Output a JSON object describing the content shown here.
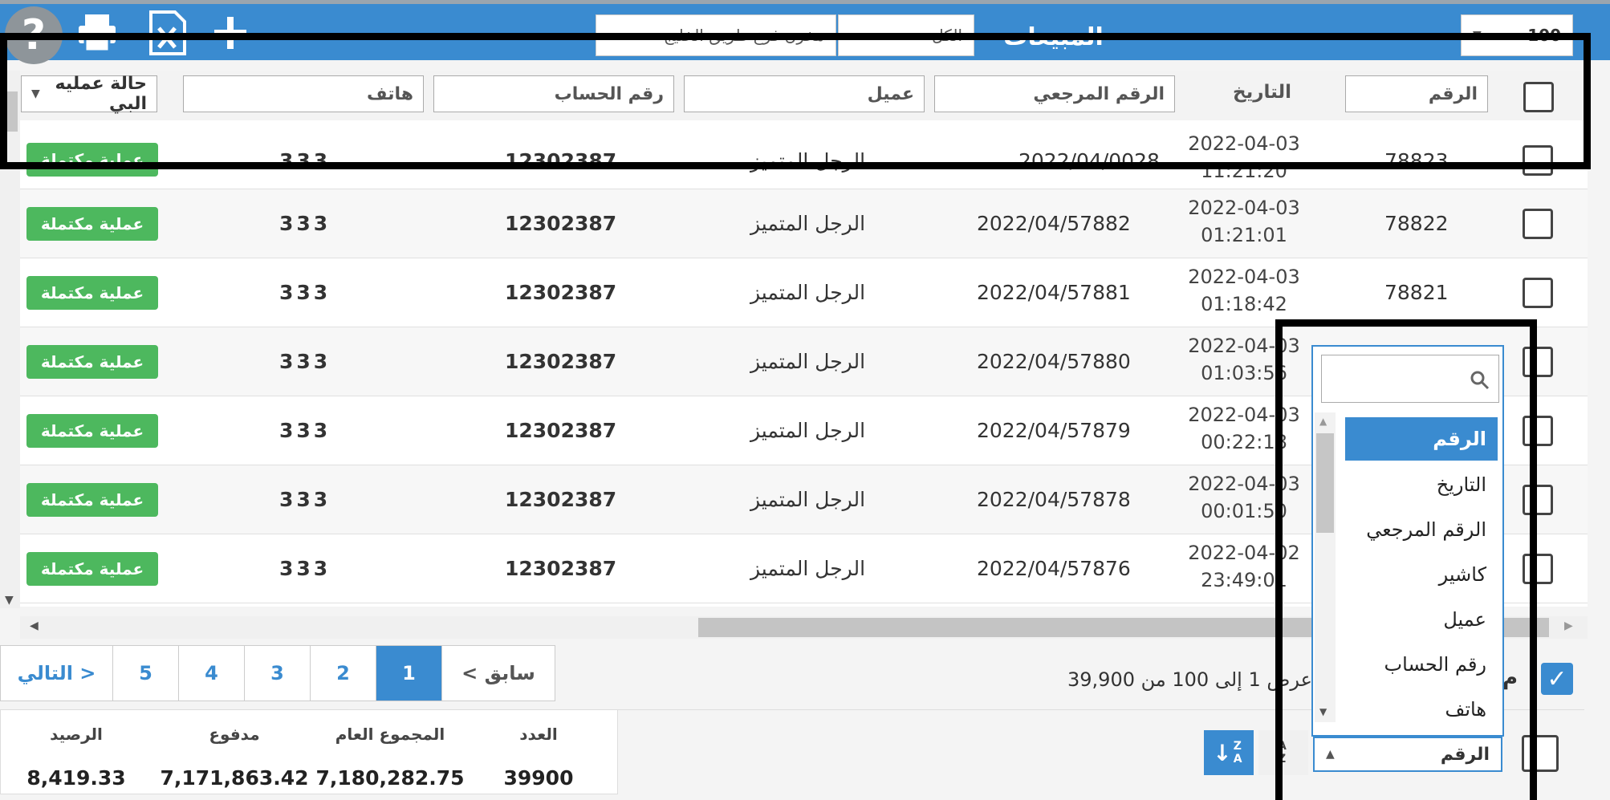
{
  "topbar": {
    "page_size": "100",
    "page_title": "المبيعات",
    "filter_all": "الكل",
    "branch": "مخزن فرع طريق الخليج",
    "help_label": "?"
  },
  "header": {
    "number": "الرقم",
    "date": "التاريخ",
    "reference": "الرقم المرجعي",
    "customer": "عميل",
    "account": "رقم الحساب",
    "phone": "هاتف",
    "status": "حالة عمليه البي"
  },
  "rows": [
    {
      "number": "78823",
      "date": "2022-04-03",
      "time": "11:21:20",
      "reference": "2022/04/0028",
      "customer": "الرجل المتميز",
      "account": "12302387",
      "phone": "333",
      "status": "عملية مكتملة"
    },
    {
      "number": "78822",
      "date": "2022-04-03",
      "time": "01:21:01",
      "reference": "2022/04/57882",
      "customer": "الرجل المتميز",
      "account": "12302387",
      "phone": "333",
      "status": "عملية مكتملة"
    },
    {
      "number": "78821",
      "date": "2022-04-03",
      "time": "01:18:42",
      "reference": "2022/04/57881",
      "customer": "الرجل المتميز",
      "account": "12302387",
      "phone": "333",
      "status": "عملية مكتملة"
    },
    {
      "number": "",
      "date": "2022-04-03",
      "time": "01:03:56",
      "reference": "2022/04/57880",
      "customer": "الرجل المتميز",
      "account": "12302387",
      "phone": "333",
      "status": "عملية مكتملة"
    },
    {
      "number": "",
      "date": "2022-04-03",
      "time": "00:22:18",
      "reference": "2022/04/57879",
      "customer": "الرجل المتميز",
      "account": "12302387",
      "phone": "333",
      "status": "عملية مكتملة"
    },
    {
      "number": "",
      "date": "2022-04-03",
      "time": "00:01:50",
      "reference": "2022/04/57878",
      "customer": "الرجل المتميز",
      "account": "12302387",
      "phone": "333",
      "status": "عملية مكتملة"
    },
    {
      "number": "",
      "date": "2022-04-02",
      "time": "23:49:01",
      "reference": "2022/04/57876",
      "customer": "الرجل المتميز",
      "account": "12302387",
      "phone": "333",
      "status": "عملية مكتملة"
    }
  ],
  "pagination": {
    "prev": "< سابق",
    "pages": [
      "1",
      "2",
      "3",
      "4",
      "5"
    ],
    "next": "التالي >",
    "showing": "عرض 1 إلى 100 من 39,900",
    "select_label": "م"
  },
  "summary": {
    "count_label": "العدد",
    "count": "39900",
    "total_label": "المجموع العام",
    "total": "7,180,282.75",
    "paid_label": "مدفوع",
    "paid": "7,171,863.42",
    "balance_label": "الرصيد",
    "balance": "8,419.33"
  },
  "sort": {
    "selected": "الرقم",
    "az_label": "A Z",
    "za_label": "Z A",
    "options": [
      "الرقم",
      "التاريخ",
      "الرقم المرجعي",
      "كاشير",
      "عميل",
      "رقم الحساب",
      "هاتف"
    ]
  },
  "colors": {
    "accent": "#3a8bd0",
    "success": "#4db85e"
  }
}
